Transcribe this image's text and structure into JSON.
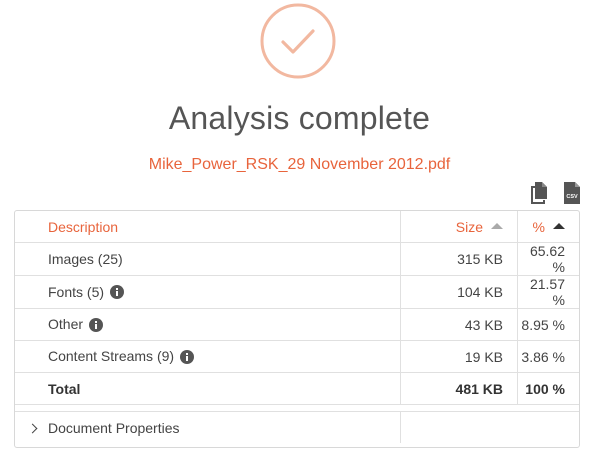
{
  "status": {
    "title": "Analysis complete",
    "filename": "Mike_Power_RSK_29 November 2012.pdf"
  },
  "colors": {
    "accent": "#e8643c",
    "check_circle": "#f2b8a0",
    "text": "#555555"
  },
  "icons": {
    "status": "check-icon",
    "export_copy": "copy-icon",
    "export_csv": "csv-file-icon",
    "info": "info-icon",
    "expand": "chevron-right-icon"
  },
  "export": {
    "csv_label": "CSV"
  },
  "table": {
    "headers": {
      "description": "Description",
      "size": "Size",
      "percent": "%"
    },
    "rows": [
      {
        "description": "Images (25)",
        "size": "315 KB",
        "percent": "65.62 %",
        "info": false
      },
      {
        "description": "Fonts (5)",
        "size": "104 KB",
        "percent": "21.57 %",
        "info": true
      },
      {
        "description": "Other",
        "size": "43 KB",
        "percent": "8.95 %",
        "info": true
      },
      {
        "description": "Content Streams (9)",
        "size": "19 KB",
        "percent": "3.86 %",
        "info": true
      }
    ],
    "total": {
      "description": "Total",
      "size": "481 KB",
      "percent": "100 %"
    },
    "properties_label": "Document Properties"
  }
}
